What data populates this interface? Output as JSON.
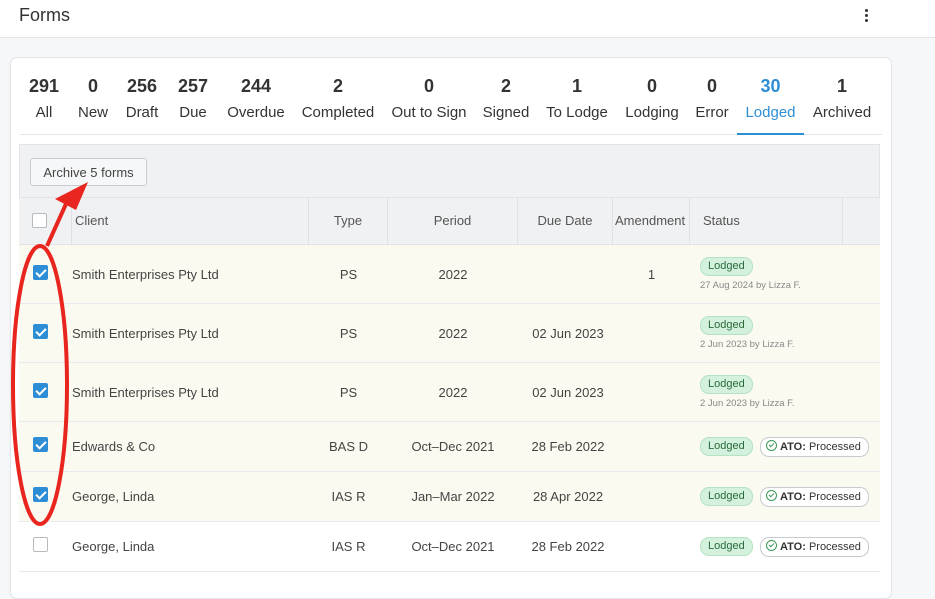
{
  "header": {
    "title": "Forms",
    "menu_icon": "kebab-menu-icon"
  },
  "tabs": [
    {
      "count": "291",
      "label": "All"
    },
    {
      "count": "0",
      "label": "New"
    },
    {
      "count": "256",
      "label": "Draft"
    },
    {
      "count": "257",
      "label": "Due"
    },
    {
      "count": "244",
      "label": "Overdue"
    },
    {
      "count": "2",
      "label": "Completed"
    },
    {
      "count": "0",
      "label": "Out to Sign"
    },
    {
      "count": "2",
      "label": "Signed"
    },
    {
      "count": "1",
      "label": "To Lodge"
    },
    {
      "count": "0",
      "label": "Lodging"
    },
    {
      "count": "0",
      "label": "Error"
    },
    {
      "count": "30",
      "label": "Lodged",
      "active": true
    },
    {
      "count": "1",
      "label": "Archived"
    }
  ],
  "toolbar": {
    "archive_label": "Archive 5 forms"
  },
  "table": {
    "headers": {
      "client": "Client",
      "type": "Type",
      "period": "Period",
      "due_date": "Due Date",
      "amendment": "Amendment",
      "status": "Status"
    },
    "rows": [
      {
        "checked": true,
        "client": "Smith Enterprises Pty Ltd",
        "type": "PS",
        "period": "2022",
        "due_date": "",
        "amendment": "1",
        "status": "Lodged",
        "status_sub": "27 Aug 2024 by Lizza F.",
        "ato": ""
      },
      {
        "checked": true,
        "client": "Smith Enterprises Pty Ltd",
        "type": "PS",
        "period": "2022",
        "due_date": "02 Jun 2023",
        "amendment": "",
        "status": "Lodged",
        "status_sub": "2 Jun 2023 by Lizza F.",
        "ato": ""
      },
      {
        "checked": true,
        "client": "Smith Enterprises Pty Ltd",
        "type": "PS",
        "period": "2022",
        "due_date": "02 Jun 2023",
        "amendment": "",
        "status": "Lodged",
        "status_sub": "2 Jun 2023 by Lizza F.",
        "ato": ""
      },
      {
        "checked": true,
        "client": "Edwards & Co",
        "type": "BAS D",
        "period": "Oct–Dec 2021",
        "due_date": "28 Feb 2022",
        "amendment": "",
        "status": "Lodged",
        "status_sub": "",
        "ato": {
          "label": "ATO:",
          "value": "Processed"
        }
      },
      {
        "checked": true,
        "client": "George, Linda",
        "type": "IAS R",
        "period": "Jan–Mar 2022",
        "due_date": "28 Apr 2022",
        "amendment": "",
        "status": "Lodged",
        "status_sub": "",
        "ato": {
          "label": "ATO:",
          "value": "Processed"
        }
      },
      {
        "checked": false,
        "client": "George, Linda",
        "type": "IAS R",
        "period": "Oct–Dec 2021",
        "due_date": "28 Feb 2022",
        "amendment": "",
        "status": "Lodged",
        "status_sub": "",
        "ato": {
          "label": "ATO:",
          "value": "Processed"
        }
      }
    ]
  },
  "colors": {
    "accent": "#2d8ed6",
    "annotation": "#e8261f",
    "lodged_bg": "#d3f1dc",
    "selected_row_bg": "#fbfaf0"
  }
}
